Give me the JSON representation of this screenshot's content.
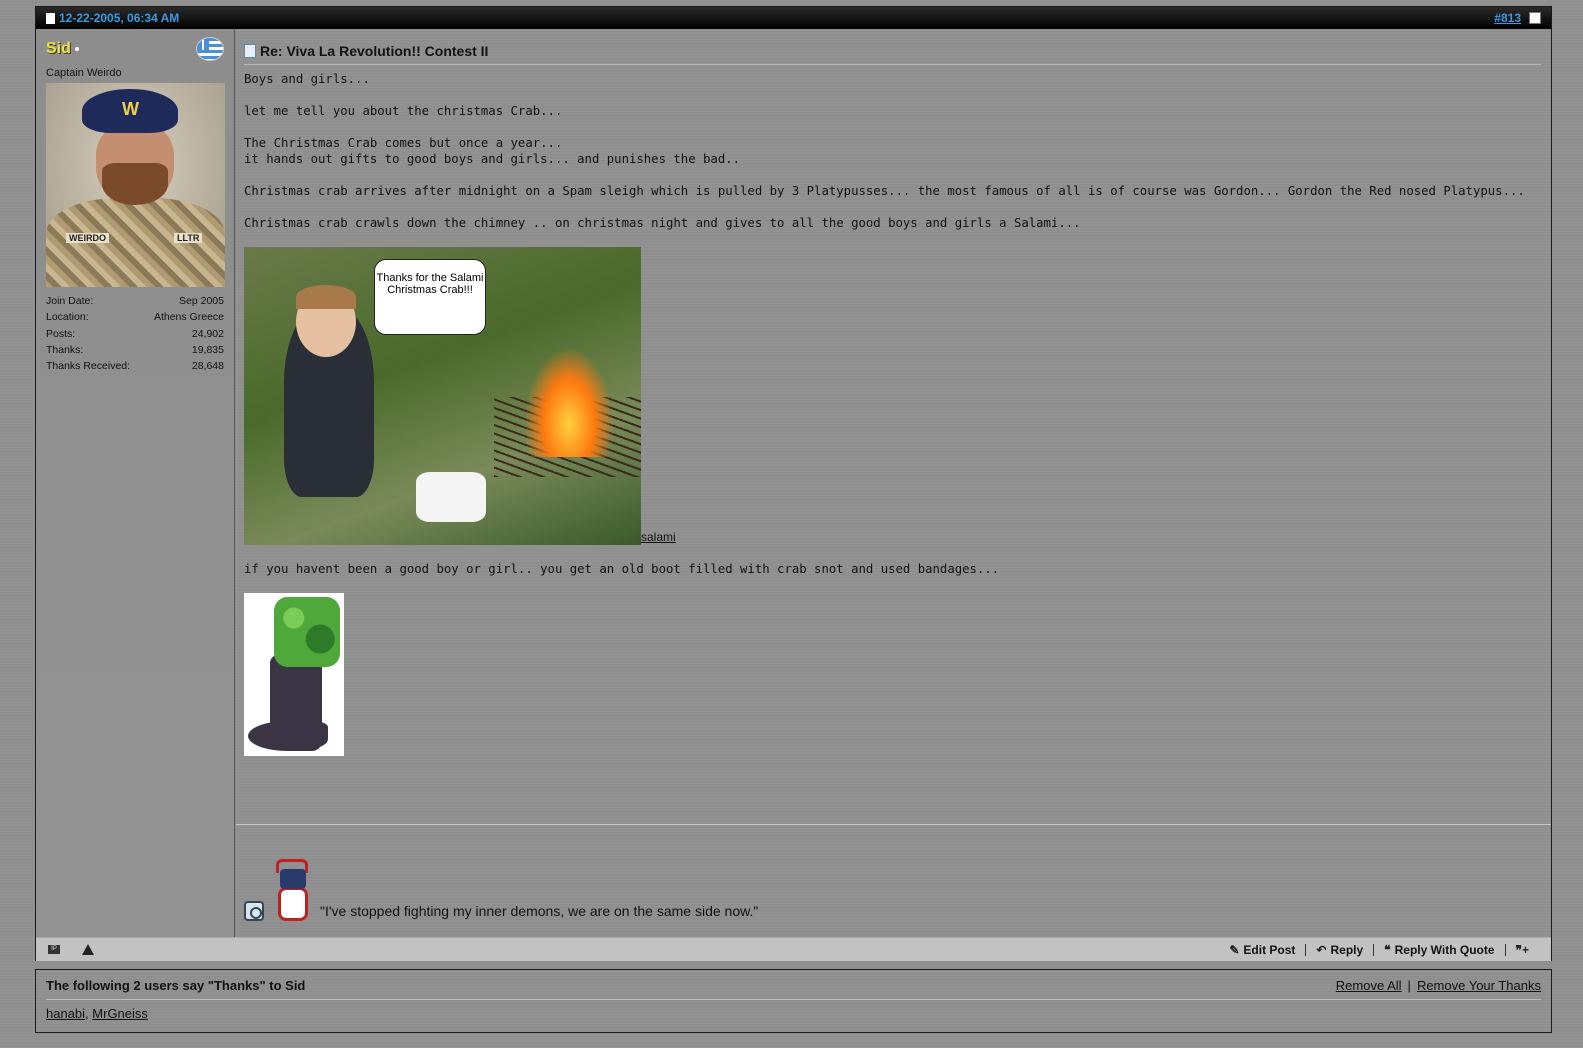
{
  "post": {
    "date": "12-22-2005, 06:34 AM",
    "number": "#813",
    "title": "Re: Viva La Revolution!! Contest II"
  },
  "user": {
    "name": "Sid",
    "title": "Captain Weirdo",
    "avatar_tags": [
      "WEIRDO",
      "LLTR"
    ],
    "avatar_beret_letter": "W",
    "stats": [
      {
        "label": "Join Date:",
        "value": "Sep 2005"
      },
      {
        "label": "Location:",
        "value": "Athens Greece"
      },
      {
        "label": "Posts:",
        "value": "24,902"
      },
      {
        "label": "Thanks:",
        "value": "19,835"
      },
      {
        "label": "Thanks Received:",
        "value": "28,648"
      }
    ]
  },
  "message": {
    "lines": [
      "Boys and girls...",
      "let me tell you about the christmas Crab...",
      "The Christmas Crab comes but once a year...",
      "it hands out gifts to good boys and girls... and punishes the bad..",
      "Christmas crab arrives after midnight on a Spam sleigh which is pulled by 3 Platypusses... the most famous of all is of course was Gordon... Gordon the Red nosed Platypus...",
      "Christmas crab crawls down the chimney .. on christmas night and gives to all the good boys and girls a Salami...",
      "if you havent been a good boy or girl.. you get an old boot filled with crab snot and used bandages..."
    ],
    "bubble_text": "Thanks for the Salami Christmas Crab!!!",
    "salami_link": "salami"
  },
  "signature": {
    "quote": "\"I've stopped fighting my inner demons, we are on the same side now.\""
  },
  "controls": {
    "ip_label": "IP",
    "edit": "Edit Post",
    "reply": "Reply",
    "reply_quote": "Reply With Quote"
  },
  "thanks": {
    "heading": "The following 2 users say \"Thanks\" to Sid",
    "remove_all": "Remove All",
    "remove_yours": "Remove Your Thanks",
    "users": [
      "hanabi",
      "MrGneiss"
    ]
  },
  "colors": {
    "username": "#f0e432",
    "link_header": "#3a9be0"
  }
}
